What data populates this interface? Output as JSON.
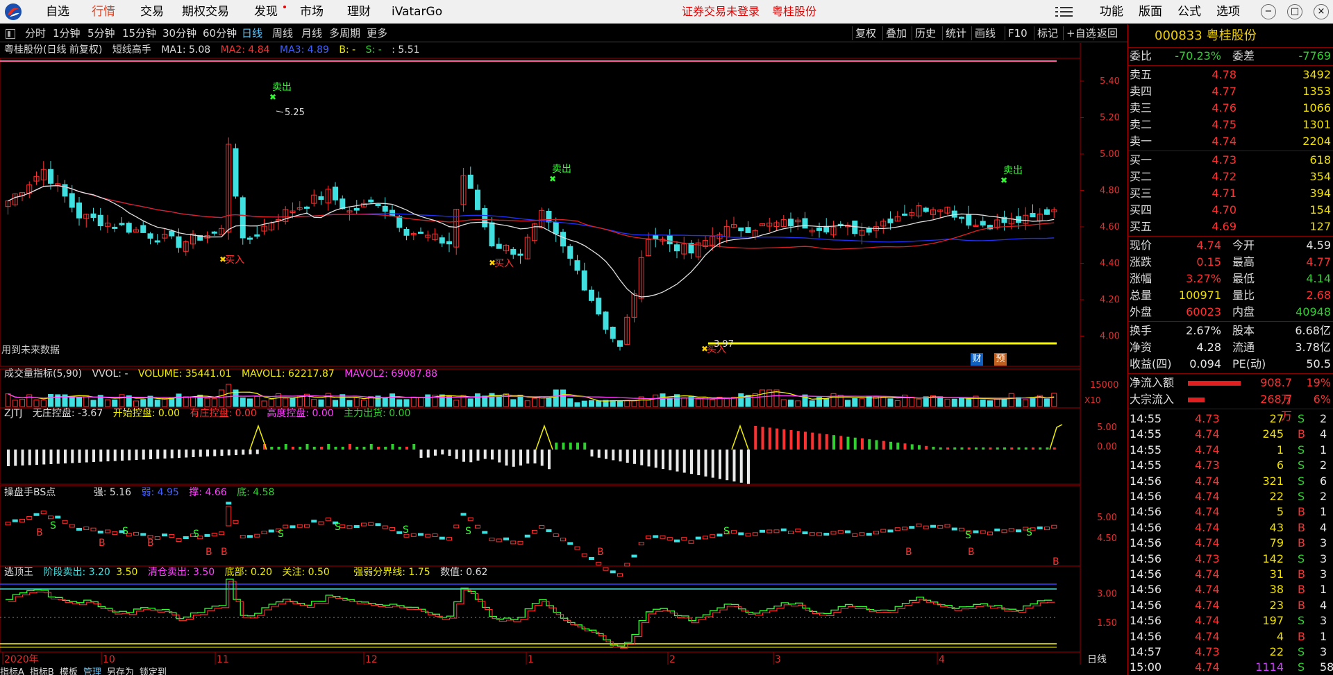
{
  "menu": {
    "items": [
      "自选",
      "行情",
      "交易",
      "期权交易",
      "发现",
      "市场",
      "理财",
      "iVatarGo"
    ],
    "active": 1,
    "alert": "证券交易未登录",
    "stock_name": "粤桂股份",
    "right_items": [
      "功能",
      "版面",
      "公式",
      "选项"
    ],
    "window_buttons": [
      "−",
      "□",
      "×"
    ]
  },
  "periods": {
    "items": [
      "分时",
      "1分钟",
      "5分钟",
      "15分钟",
      "30分钟",
      "60分钟",
      "日线",
      "周线",
      "月线",
      "多周期",
      "更多"
    ],
    "active": 6
  },
  "tools": [
    "复权",
    "叠加",
    "历史",
    "统计",
    "画线",
    "F10",
    "标记",
    "+自选",
    "返回"
  ],
  "main": {
    "header": [
      "粤桂股份(日线 前复权)",
      "短线高手",
      "MA1: 5.08",
      "MA2: 4.84",
      "MA3: 4.89",
      "B: -",
      "S: -",
      ": 5.51"
    ],
    "price_ticks": [
      "5.40",
      "5.20",
      "5.00",
      "4.80",
      "4.60",
      "4.40",
      "4.20",
      "4.00"
    ],
    "annot_high": "5.25",
    "annot_low": "3.97",
    "signals": {
      "sell": "卖出",
      "buy": "买入"
    },
    "footnote": "用到未来数据",
    "badges": [
      "财",
      "预"
    ],
    "colors": {
      "up": "#ff3030",
      "down": "#40e0e0",
      "ma_white": "#e0e0e0",
      "ma_red": "#e02020",
      "ma_blue": "#2030ff"
    }
  },
  "vol": {
    "header": [
      "成交量指标(5,90)",
      "VVOL: -",
      "VOLUME: 35441.01",
      "MAVOL1: 62217.87",
      "MAVOL2: 69087.88"
    ],
    "tick": "15000",
    "unit": "X10"
  },
  "zjtj": {
    "header": [
      "ZJTJ",
      "无庄控盘: -3.67",
      "开始控盘: 0.00",
      "有庄控盘: 0.00",
      "高度控盘: 0.00",
      "主力出货: 0.00"
    ],
    "ticks": [
      "5.00",
      "0.00"
    ]
  },
  "bs": {
    "header": [
      "操盘手BS点",
      "强: 5.16",
      "弱: 4.95",
      "撑: 4.66",
      "底: 4.58"
    ],
    "ticks": [
      "5.00",
      "4.50"
    ],
    "mark_b": "B",
    "mark_s": "S"
  },
  "top": {
    "header": [
      "逃顶王",
      "阶段卖出: 3.20",
      "3.50",
      "清仓卖出: 3.50",
      "底部: 0.20",
      "关注: 0.50",
      "强弱分界线: 1.75",
      "数值: 0.62"
    ],
    "ticks": [
      "3.00",
      "1.50"
    ]
  },
  "date_axis": [
    "2020年",
    "10",
    "11",
    "12",
    "1",
    "2",
    "3",
    "4"
  ],
  "period_label": "日线",
  "bottom_tabs": [
    "指标A",
    "指标B",
    "模板",
    "管理",
    "另存为",
    "锁定到"
  ],
  "quote": {
    "code": "000833",
    "name": "粤桂股份",
    "weibi": {
      "label": "委比",
      "value": "-70.23%",
      "label2": "委差",
      "value2": "-7769"
    },
    "sells": [
      {
        "label": "卖五",
        "price": "4.78",
        "vol": "3492"
      },
      {
        "label": "卖四",
        "price": "4.77",
        "vol": "1353"
      },
      {
        "label": "卖三",
        "price": "4.76",
        "vol": "1066"
      },
      {
        "label": "卖二",
        "price": "4.75",
        "vol": "1301"
      },
      {
        "label": "卖一",
        "price": "4.74",
        "vol": "2204"
      }
    ],
    "buys": [
      {
        "label": "买一",
        "price": "4.73",
        "vol": "618"
      },
      {
        "label": "买二",
        "price": "4.72",
        "vol": "354"
      },
      {
        "label": "买三",
        "price": "4.71",
        "vol": "394"
      },
      {
        "label": "买四",
        "price": "4.70",
        "vol": "154"
      },
      {
        "label": "买五",
        "price": "4.69",
        "vol": "127"
      }
    ],
    "stats": [
      {
        "l1": "现价",
        "v1": "4.74",
        "l2": "今开",
        "v2": "4.59"
      },
      {
        "l1": "涨跌",
        "v1": "0.15",
        "l2": "最高",
        "v2": "4.77"
      },
      {
        "l1": "涨幅",
        "v1": "3.27%",
        "l2": "最低",
        "v2": "4.14"
      },
      {
        "l1": "总量",
        "v1": "100971",
        "l2": "量比",
        "v2": "2.68"
      },
      {
        "l1": "外盘",
        "v1": "60023",
        "l2": "内盘",
        "v2": "40948"
      }
    ],
    "fin": [
      {
        "l1": "换手",
        "v1": "2.67%",
        "l2": "股本",
        "v2": "6.68亿"
      },
      {
        "l1": "净资",
        "v1": "4.28",
        "l2": "流通",
        "v2": "3.78亿"
      },
      {
        "l1": "收益(四)",
        "v1": "0.094",
        "l2": "PE(动)",
        "v2": "50.5"
      }
    ],
    "flow": [
      {
        "label": "净流入额",
        "value": "908.7万",
        "pct": "19%",
        "fill": 0.19
      },
      {
        "label": "大宗流入",
        "value": "268.7万",
        "pct": "6%",
        "fill": 0.06
      }
    ],
    "ticks": [
      {
        "t": "14:55",
        "p": "4.73",
        "v": "27",
        "s": "S",
        "n": "2"
      },
      {
        "t": "14:55",
        "p": "4.74",
        "v": "245",
        "s": "B",
        "n": "4"
      },
      {
        "t": "14:55",
        "p": "4.74",
        "v": "1",
        "s": "S",
        "n": "1"
      },
      {
        "t": "14:55",
        "p": "4.73",
        "v": "6",
        "s": "S",
        "n": "2"
      },
      {
        "t": "14:56",
        "p": "4.74",
        "v": "321",
        "s": "S",
        "n": "6"
      },
      {
        "t": "14:56",
        "p": "4.74",
        "v": "22",
        "s": "S",
        "n": "2"
      },
      {
        "t": "14:56",
        "p": "4.74",
        "v": "5",
        "s": "B",
        "n": "1"
      },
      {
        "t": "14:56",
        "p": "4.74",
        "v": "43",
        "s": "B",
        "n": "4"
      },
      {
        "t": "14:56",
        "p": "4.74",
        "v": "79",
        "s": "B",
        "n": "3"
      },
      {
        "t": "14:56",
        "p": "4.73",
        "v": "142",
        "s": "S",
        "n": "3"
      },
      {
        "t": "14:56",
        "p": "4.74",
        "v": "31",
        "s": "B",
        "n": "3"
      },
      {
        "t": "14:56",
        "p": "4.74",
        "v": "38",
        "s": "B",
        "n": "1"
      },
      {
        "t": "14:56",
        "p": "4.74",
        "v": "23",
        "s": "B",
        "n": "4"
      },
      {
        "t": "14:56",
        "p": "4.74",
        "v": "197",
        "s": "S",
        "n": "3"
      },
      {
        "t": "14:56",
        "p": "4.74",
        "v": "4",
        "s": "B",
        "n": "1"
      },
      {
        "t": "14:57",
        "p": "4.73",
        "v": "22",
        "s": "S",
        "n": "3"
      },
      {
        "t": "15:00",
        "p": "4.74",
        "v": "1114",
        "s": "S",
        "n": "58"
      }
    ]
  }
}
